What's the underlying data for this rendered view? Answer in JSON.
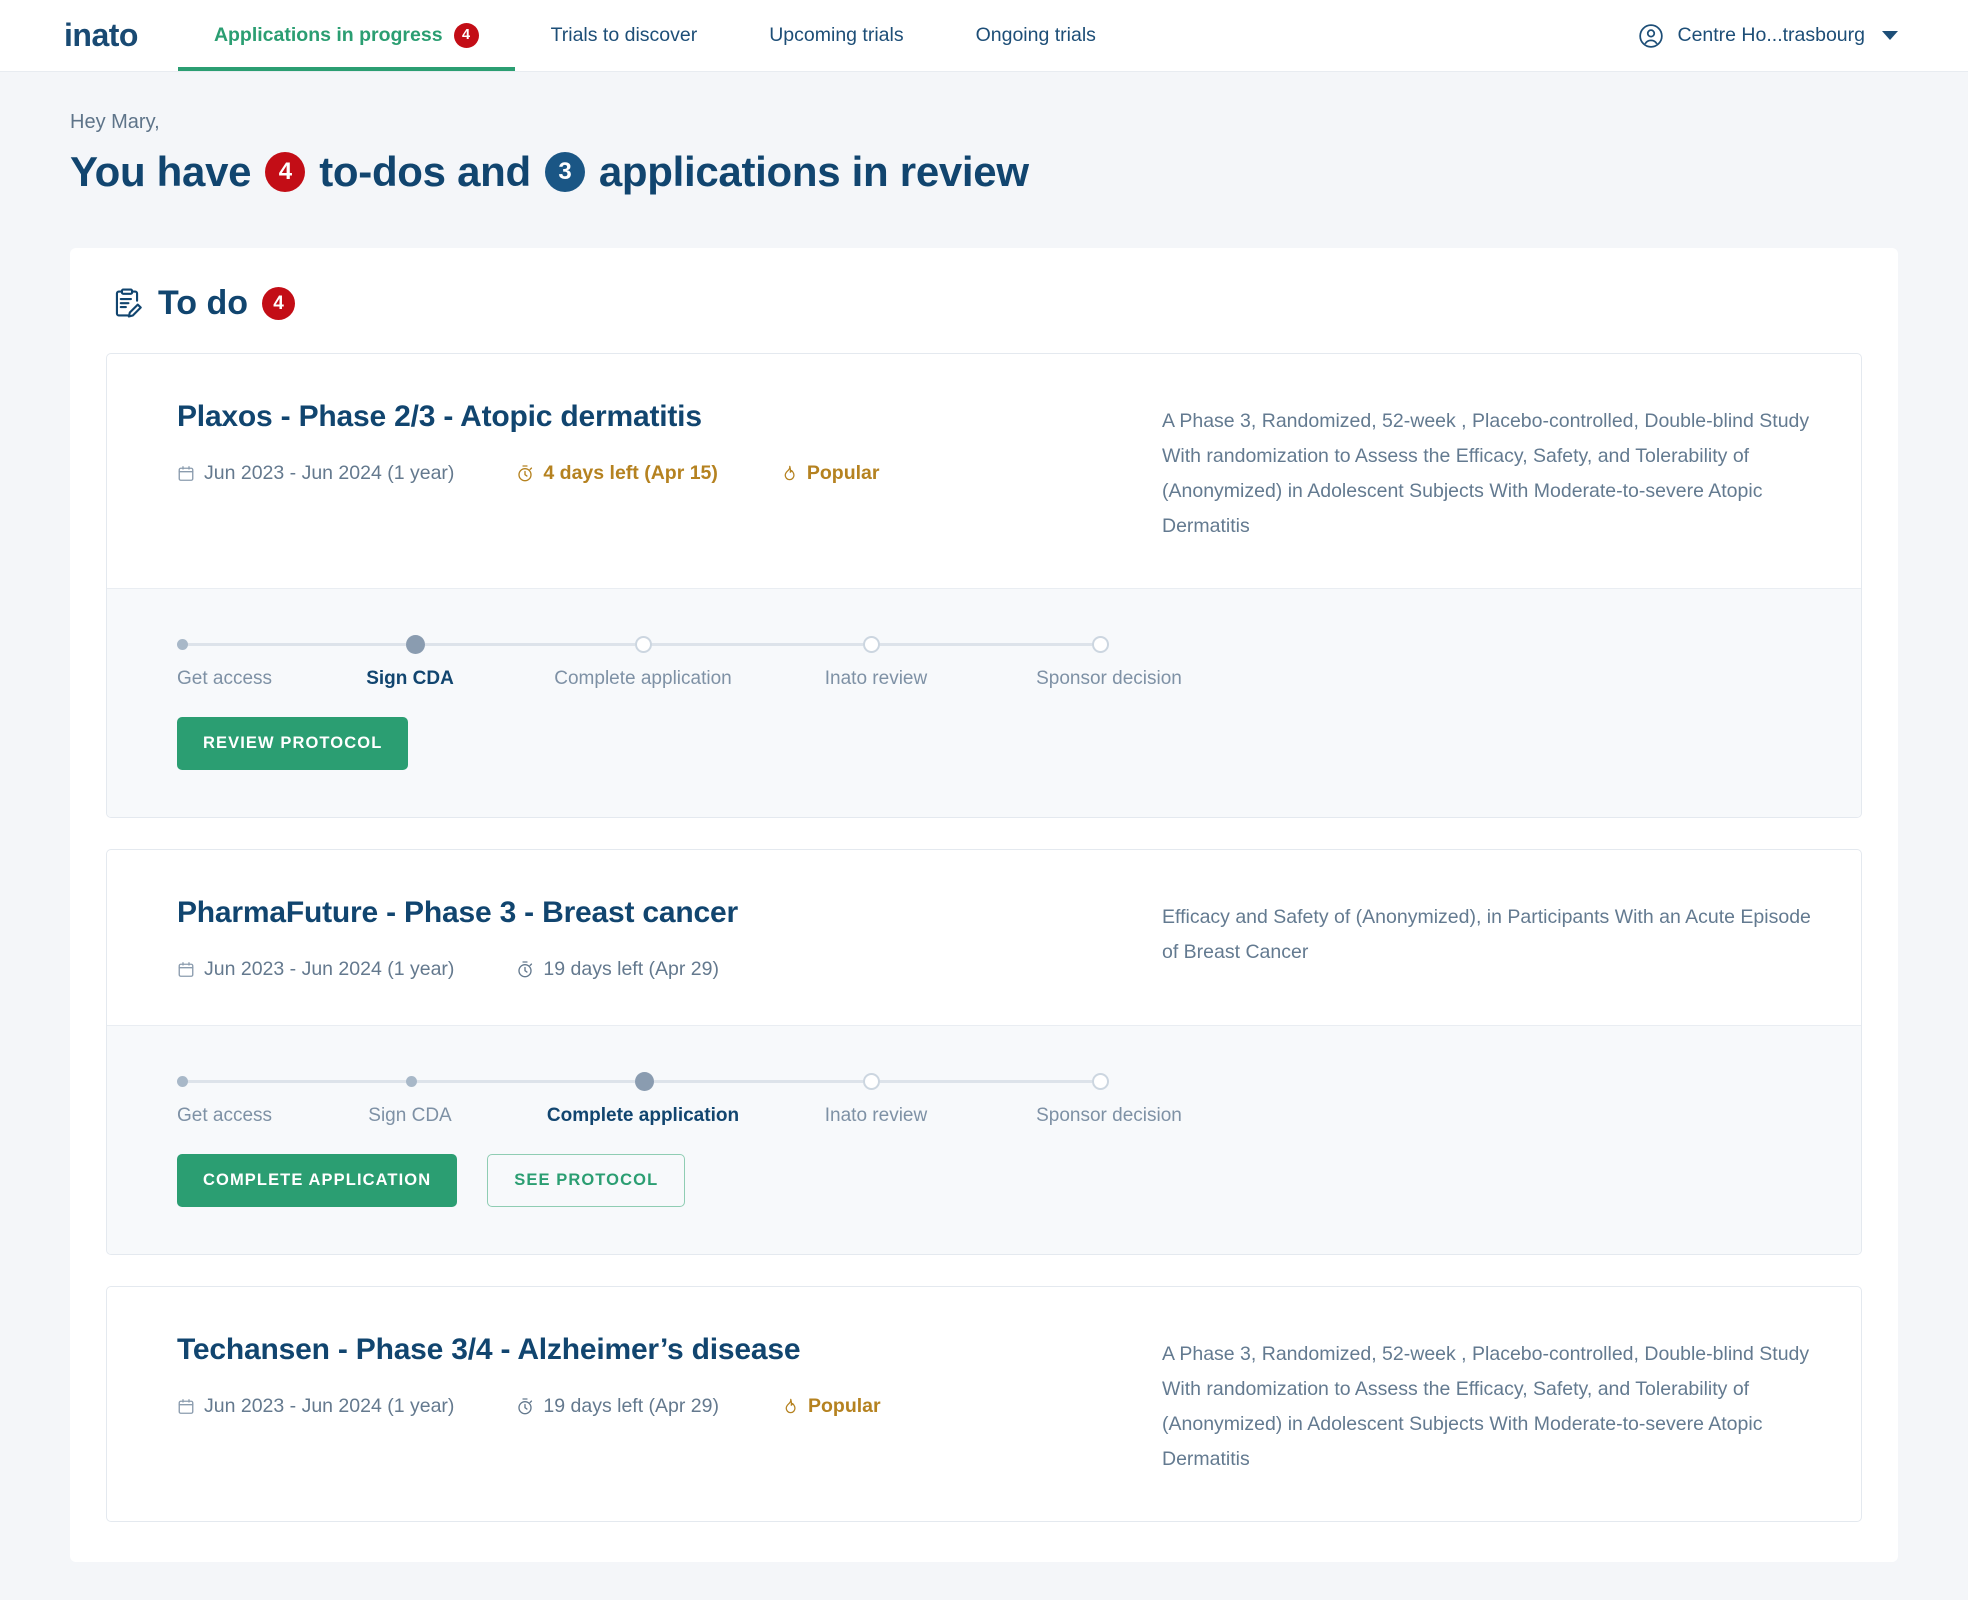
{
  "brand": {
    "name": "inato",
    "accent_green": "#2b9e72",
    "accent_navy": "#11456f",
    "badge_red": "#c30d16",
    "badge_blue": "#1a5685",
    "warning_gold": "#b58220"
  },
  "topbar": {
    "tabs": [
      {
        "label": "Applications in progress",
        "badge": "4",
        "active": true
      },
      {
        "label": "Trials to discover",
        "badge": "",
        "active": false
      },
      {
        "label": "Upcoming trials",
        "badge": "",
        "active": false
      },
      {
        "label": "Ongoing trials",
        "badge": "",
        "active": false
      }
    ],
    "account": {
      "label": "Centre Ho...trasbourg",
      "icon": "user-circle-icon",
      "caret": "chevron-down-icon"
    }
  },
  "greeting": {
    "hey": "Hey Mary,",
    "headline_part1": "You have",
    "todo_count": "4",
    "headline_part2": "to-dos and",
    "review_count": "3",
    "headline_part3": "applications in review"
  },
  "todo_section": {
    "icon": "clipboard-pencil-icon",
    "title": "To do",
    "count": "4"
  },
  "cards": [
    {
      "title": "Plaxos - Phase 2/3 - Atopic dermatitis",
      "dates": "Jun 2023 - Jun 2024 (1 year)",
      "deadline": "4 days left (Apr 15)",
      "deadline_urgent": true,
      "popular": "Popular",
      "has_popular": true,
      "description": "A Phase 3, Randomized, 52-week , Placebo-controlled, Double-blind Study With randomization to Assess the Efficacy, Safety, and Tolerability of (Anonymized) in Adolescent Subjects With Moderate-to-severe Atopic Dermatitis",
      "steps": [
        {
          "label": "Get access",
          "state": "done"
        },
        {
          "label": "Sign CDA",
          "state": "current"
        },
        {
          "label": "Complete application",
          "state": "pending"
        },
        {
          "label": "Inato review",
          "state": "pending"
        },
        {
          "label": "Sponsor decision",
          "state": "pending"
        }
      ],
      "buttons": [
        {
          "label": "REVIEW PROTOCOL",
          "style": "primary"
        }
      ]
    },
    {
      "title": "PharmaFuture - Phase 3 - Breast cancer",
      "dates": "Jun 2023 - Jun 2024 (1 year)",
      "deadline": "19 days left (Apr 29)",
      "deadline_urgent": false,
      "popular": "",
      "has_popular": false,
      "description": "Efficacy and Safety of (Anonymized), in Participants With an Acute Episode of Breast Cancer",
      "steps": [
        {
          "label": "Get access",
          "state": "done"
        },
        {
          "label": "Sign CDA",
          "state": "done"
        },
        {
          "label": "Complete application",
          "state": "current"
        },
        {
          "label": "Inato review",
          "state": "pending"
        },
        {
          "label": "Sponsor decision",
          "state": "pending"
        }
      ],
      "buttons": [
        {
          "label": "COMPLETE APPLICATION",
          "style": "primary"
        },
        {
          "label": "SEE PROTOCOL",
          "style": "outline"
        }
      ]
    },
    {
      "title": "Techansen - Phase 3/4 - Alzheimer’s disease",
      "dates": "Jun 2023 - Jun 2024 (1 year)",
      "deadline": "19 days left (Apr 29)",
      "deadline_urgent": false,
      "popular": "Popular",
      "has_popular": true,
      "description": "A Phase 3, Randomized, 52-week , Placebo-controlled, Double-blind Study With randomization to Assess the Efficacy, Safety, and Tolerability of (Anonymized) in Adolescent Subjects With Moderate-to-severe Atopic Dermatitis",
      "steps": [],
      "buttons": []
    }
  ],
  "icons": {
    "calendar": "calendar-icon",
    "stopwatch": "stopwatch-icon",
    "flame": "flame-icon"
  }
}
